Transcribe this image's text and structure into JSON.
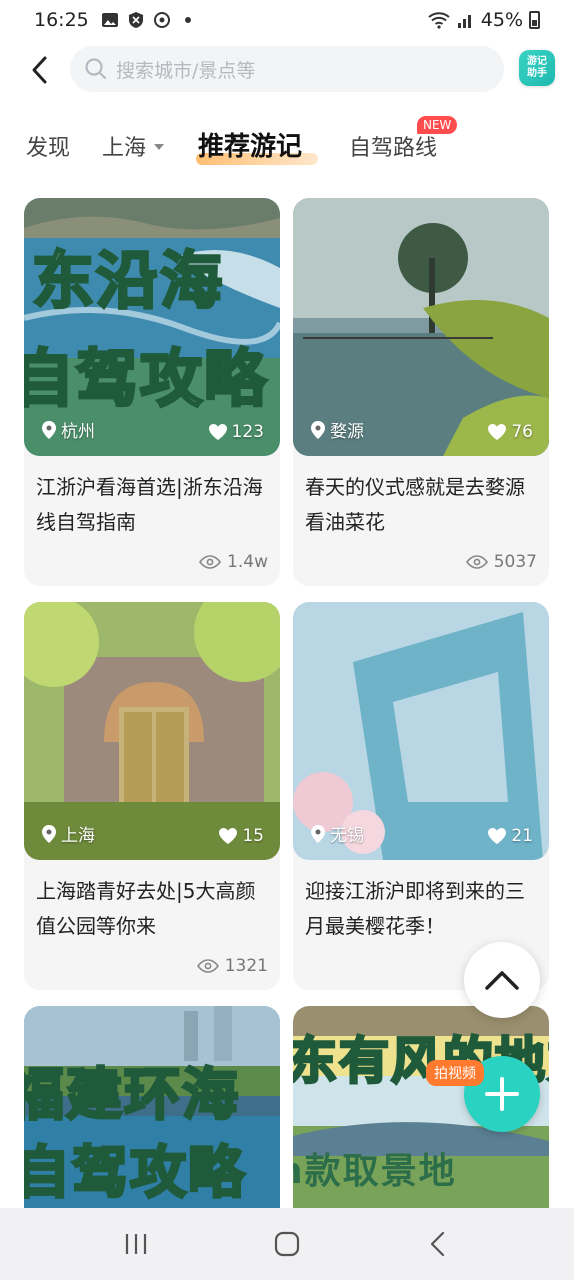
{
  "status_bar": {
    "time": "16:25",
    "battery": "45%"
  },
  "header": {
    "search_placeholder": "搜索城市/景点等",
    "assistant_label": "游记助手"
  },
  "tabs": {
    "discover": "发现",
    "city": "上海",
    "recommended": "推荐游记",
    "self_drive": "自驾路线",
    "new_badge": "NEW"
  },
  "feed": [
    {
      "location": "杭州",
      "likes": "123",
      "title": "江浙沪看海首选|浙东沿海线自驾指南",
      "views": "1.4w",
      "overlay": [
        "东沿海",
        "自驾攻略"
      ]
    },
    {
      "location": "婺源",
      "likes": "76",
      "title": "春天的仪式感就是去婺源看油菜花",
      "views": "5037"
    },
    {
      "location": "上海",
      "likes": "15",
      "title": "上海踏青好去处|5大高颜值公园等你来",
      "views": "1321"
    },
    {
      "location": "无锡",
      "likes": "21",
      "title": "迎接江浙沪即将到来的三月最美樱花季！",
      "views": ""
    },
    {
      "overlay": [
        "福建环海",
        "自驾攻略"
      ]
    },
    {
      "overlay": [
        "东有风的地方",
        "n款取景地"
      ]
    }
  ],
  "fab": {
    "badge": "拍视频"
  }
}
